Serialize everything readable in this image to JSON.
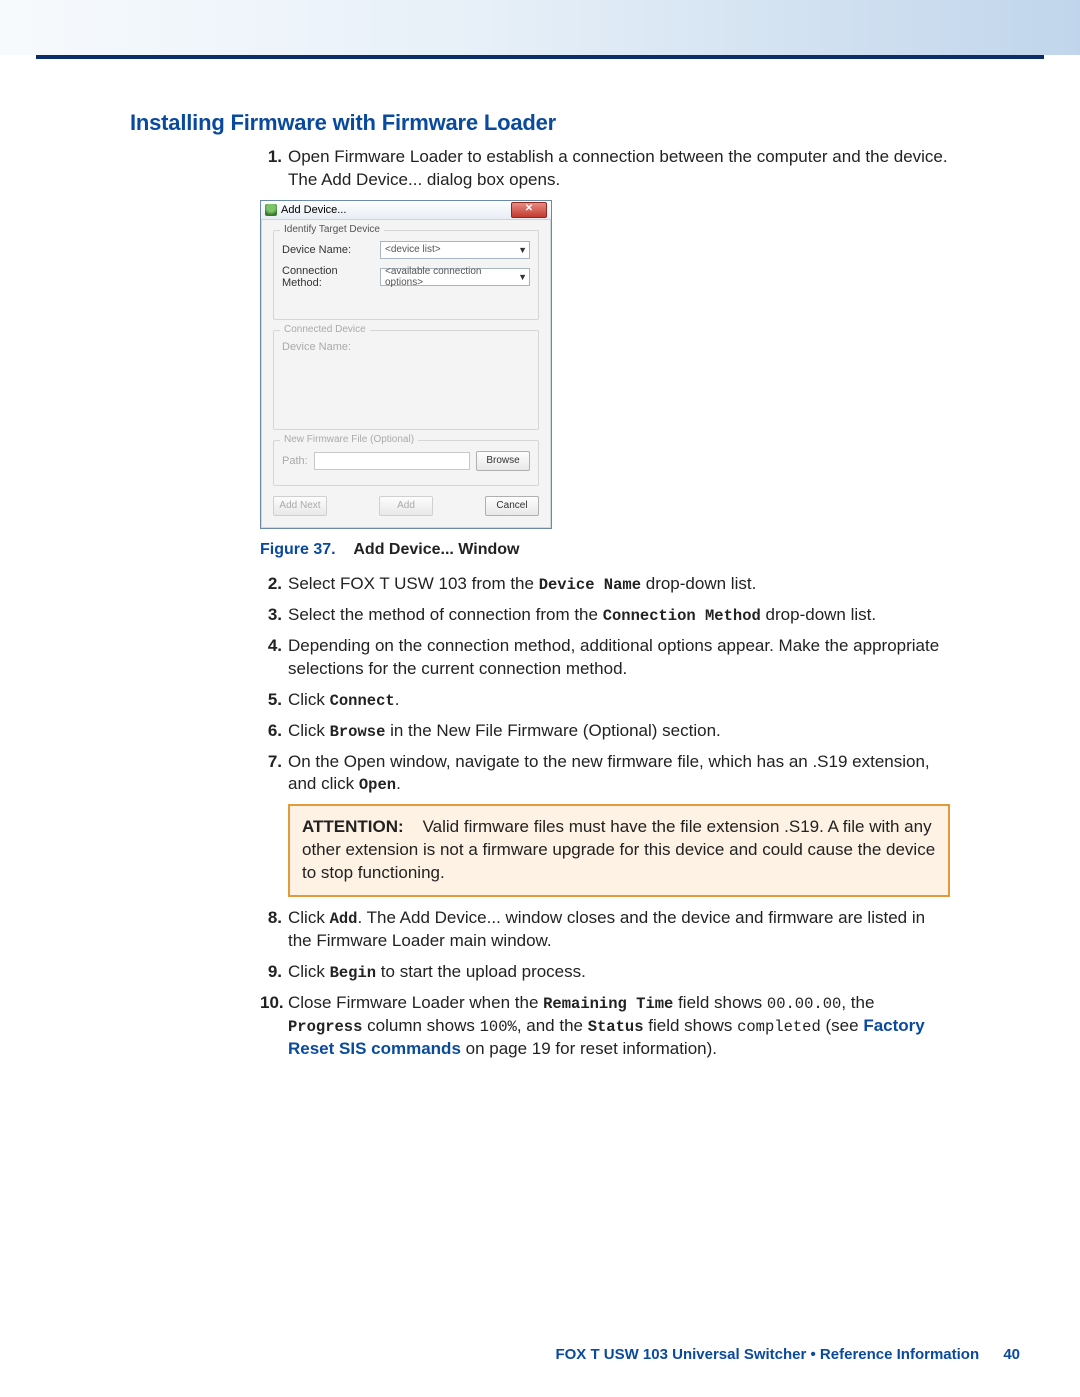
{
  "section_title": "Installing Firmware with Firmware Loader",
  "steps": {
    "s1": {
      "num": "1.",
      "text": "Open Firmware Loader to establish a connection between the computer and the device. The Add Device... dialog box opens."
    },
    "s2": {
      "num": "2.",
      "pre": "Select FOX T USW 103 from the ",
      "mono": "Device Name",
      "post": " drop-down list."
    },
    "s3": {
      "num": "3.",
      "pre": "Select the method of connection from the ",
      "mono": "Connection Method",
      "post": " drop-down list."
    },
    "s4": {
      "num": "4.",
      "text": "Depending on the connection method, additional options appear. Make the appropriate selections for the current connection method."
    },
    "s5": {
      "num": "5.",
      "pre": "Click ",
      "mono": "Connect",
      "post": "."
    },
    "s6": {
      "num": "6.",
      "pre": "Click ",
      "mono": "Browse",
      "post": " in the New File Firmware (Optional) section."
    },
    "s7": {
      "num": "7.",
      "pre": "On the Open window, navigate to the new firmware file, which has an .S19 extension, and click ",
      "mono": "Open",
      "post": "."
    },
    "s8": {
      "num": "8.",
      "pre": "Click ",
      "mono": "Add",
      "post": ". The Add Device... window closes and the device and firmware are listed in the Firmware Loader main window."
    },
    "s9": {
      "num": "9.",
      "pre": "Click ",
      "mono": "Begin",
      "post": " to start the upload process."
    },
    "s10": {
      "num": "10.",
      "a": "Close Firmware Loader when the ",
      "m1": "Remaining Time",
      "b": " field shows ",
      "v1": "00.00.00",
      "c": ", the ",
      "m2": "Progress",
      "d": " column shows ",
      "v2": "100%",
      "e": ", and the ",
      "m3": "Status",
      "f": " field shows ",
      "v3": "completed",
      "g": " (see ",
      "link": "Factory Reset SIS commands",
      "h": " on page 19 for reset information)."
    }
  },
  "dialog": {
    "title": "Add Device...",
    "close_glyph": "✕",
    "group_identify": "Identify Target Device",
    "lbl_device_name": "Device Name:",
    "combo_device_name": "<device list>",
    "lbl_conn_method": "Connection Method:",
    "combo_conn_method": "<available connection options>",
    "group_connected": "Connected Device",
    "lbl_connected_name": "Device Name:",
    "group_firmware": "New Firmware File (Optional)",
    "lbl_path": "Path:",
    "btn_browse": "Browse",
    "btn_add_next": "Add Next",
    "btn_add": "Add",
    "btn_cancel": "Cancel"
  },
  "figure": {
    "num": "Figure 37.",
    "title": "Add Device... Window"
  },
  "attention": {
    "label": "ATTENTION:",
    "text": "Valid firmware files must have the file extension .S19. A file with any other extension is not a firmware upgrade for this device and could cause the device to stop functioning."
  },
  "footer": {
    "doc": "FOX T USW 103 Universal Switcher • Reference Information",
    "page": "40"
  }
}
